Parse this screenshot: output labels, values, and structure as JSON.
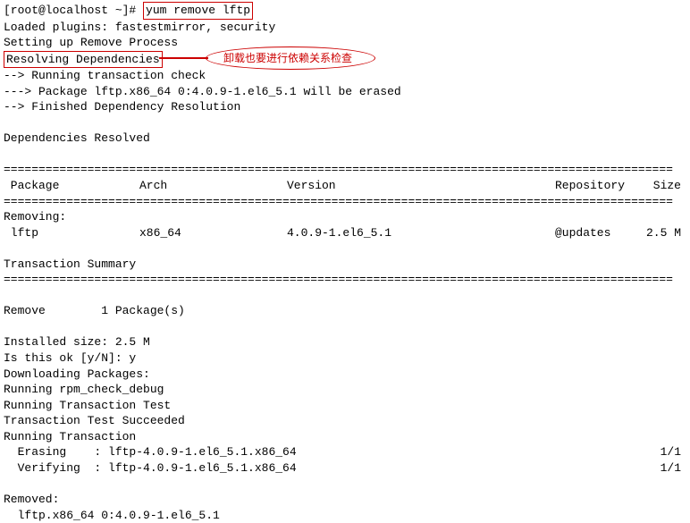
{
  "prompt": "[root@localhost ~]# ",
  "command": "yum remove lftp",
  "l1": "Loaded plugins: fastestmirror, security",
  "l2": "Setting up Remove Process",
  "l3": "Resolving Dependencies",
  "annotation": "卸载也要进行依赖关系检查",
  "l4": "--> Running transaction check",
  "l5": "---> Package lftp.x86_64 0:4.0.9-1.el6_5.1 will be erased",
  "l6": "--> Finished Dependency Resolution",
  "l7": "Dependencies Resolved",
  "sep": "================================================================================================",
  "hdr": {
    "pkg": " Package",
    "arch": "Arch",
    "ver": "Version",
    "repo": "Repository",
    "size": "Size"
  },
  "l8": "Removing:",
  "row": {
    "pkg": " lftp",
    "arch": "x86_64",
    "ver": "4.0.9-1.el6_5.1",
    "repo": "@updates",
    "size": "2.5 M"
  },
  "l9": "Transaction Summary",
  "l10": "Remove        1 Package(s)",
  "l11": "Installed size: 2.5 M",
  "l12": "Is this ok [y/N]: y",
  "l13": "Downloading Packages:",
  "l14": "Running rpm_check_debug",
  "l15": "Running Transaction Test",
  "l16": "Transaction Test Succeeded",
  "l17": "Running Transaction",
  "tx1": {
    "l": "  Erasing    : lftp-4.0.9-1.el6_5.1.x86_64",
    "r": "1/1"
  },
  "tx2": {
    "l": "  Verifying  : lftp-4.0.9-1.el6_5.1.x86_64",
    "r": "1/1"
  },
  "l18": "Removed:",
  "l19": "  lftp.x86_64 0:4.0.9-1.el6_5.1"
}
